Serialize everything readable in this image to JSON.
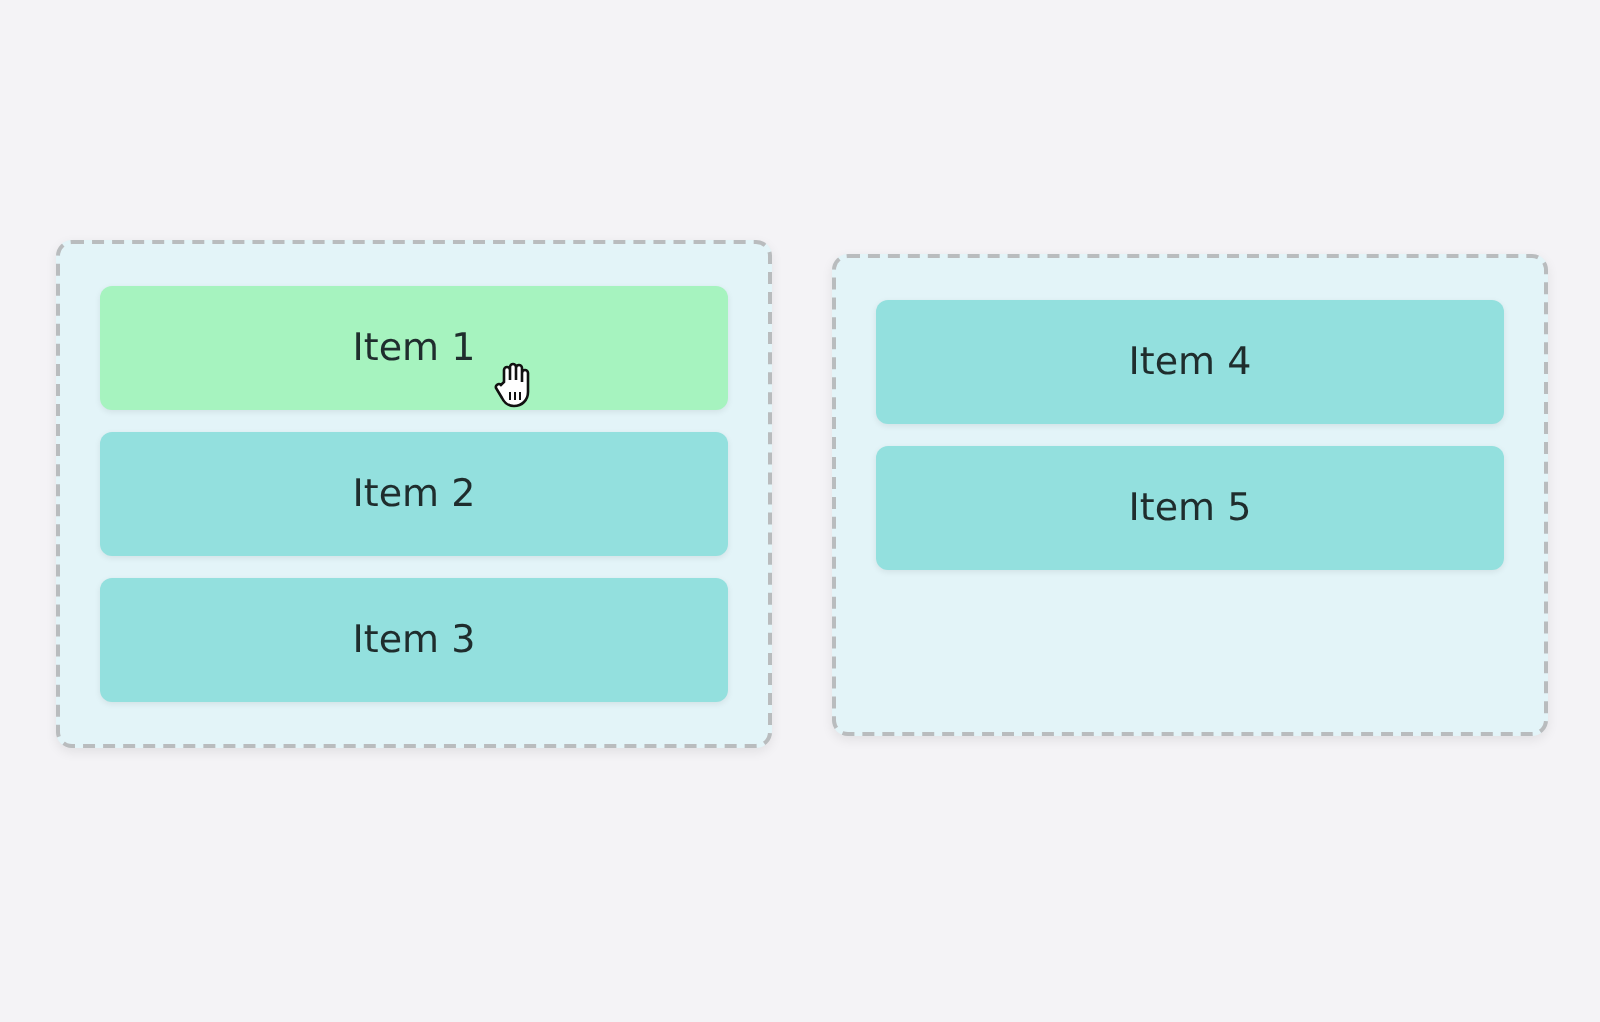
{
  "lists": [
    {
      "items": [
        {
          "label": "Item 1",
          "selected": true
        },
        {
          "label": "Item 2",
          "selected": false
        },
        {
          "label": "Item 3",
          "selected": false
        }
      ]
    },
    {
      "items": [
        {
          "label": "Item 4",
          "selected": false
        },
        {
          "label": "Item 5",
          "selected": false
        }
      ]
    }
  ]
}
